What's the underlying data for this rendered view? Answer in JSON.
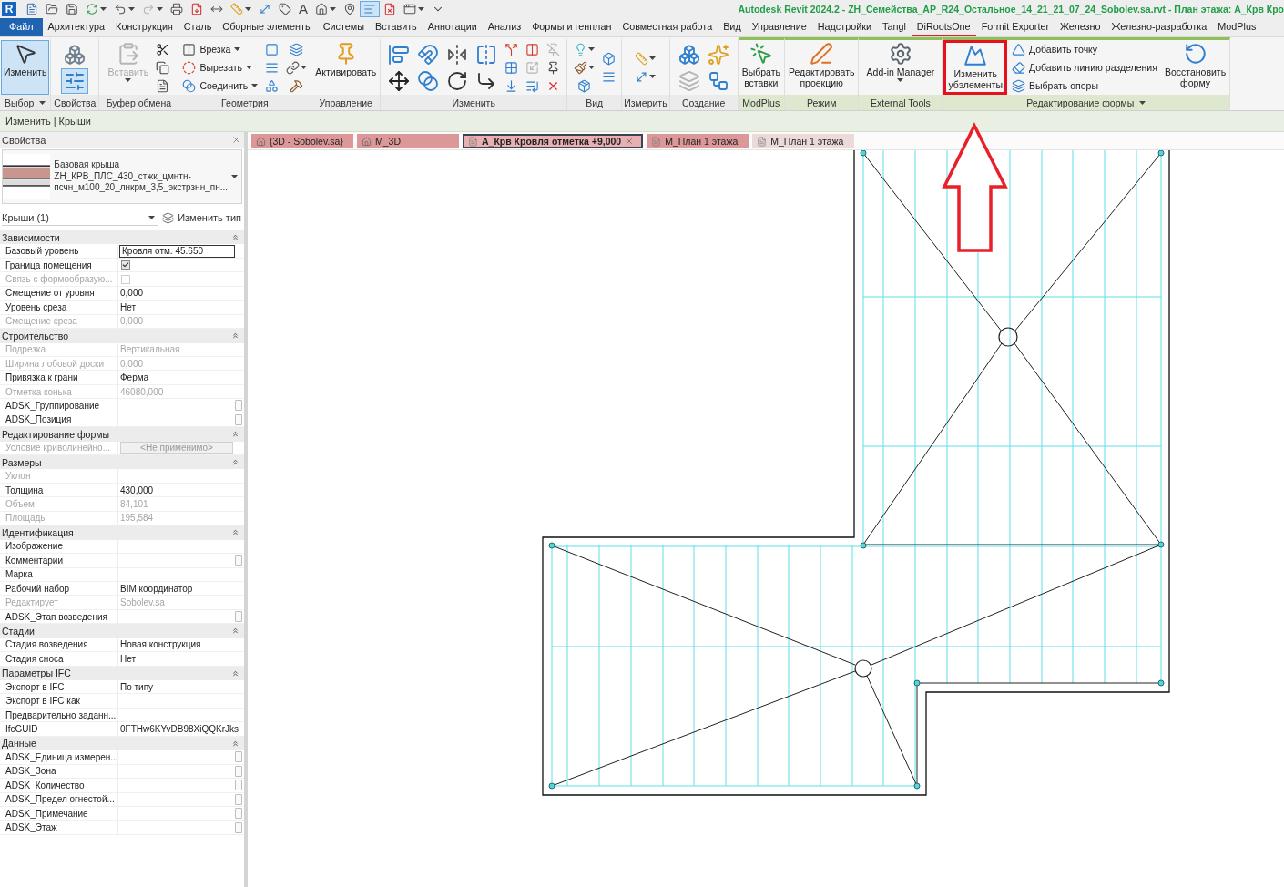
{
  "title_bar": {
    "logo": "R",
    "quick_access": [
      {
        "kind": "icon",
        "selected": false,
        "disabled": false,
        "dropdown": false
      },
      {
        "kind": "icon",
        "selected": false,
        "disabled": false,
        "dropdown": false
      },
      {
        "kind": "icon",
        "selected": false,
        "disabled": false,
        "dropdown": false
      },
      {
        "kind": "icon",
        "selected": false,
        "disabled": false,
        "dropdown": true
      },
      {
        "kind": "icon",
        "selected": false,
        "disabled": false,
        "dropdown": true
      },
      {
        "kind": "icon",
        "selected": false,
        "disabled": true,
        "dropdown": true
      },
      {
        "kind": "icon",
        "selected": false,
        "disabled": false,
        "dropdown": false
      },
      {
        "kind": "icon",
        "selected": false,
        "disabled": false,
        "dropdown": false
      },
      {
        "kind": "icon",
        "selected": false,
        "disabled": false,
        "dropdown": false
      },
      {
        "kind": "icon",
        "selected": false,
        "disabled": false,
        "dropdown": true
      },
      {
        "kind": "icon",
        "selected": false,
        "disabled": false,
        "dropdown": false
      },
      {
        "kind": "icon",
        "selected": false,
        "disabled": false,
        "dropdown": false
      },
      {
        "kind": "glyph",
        "label": "A",
        "selected": false,
        "disabled": false,
        "dropdown": false
      },
      {
        "kind": "icon",
        "selected": false,
        "disabled": false,
        "dropdown": true
      },
      {
        "kind": "icon",
        "selected": false,
        "disabled": false,
        "dropdown": false
      },
      {
        "kind": "icon",
        "selected": true,
        "disabled": false,
        "dropdown": false
      },
      {
        "kind": "icon",
        "selected": false,
        "disabled": false,
        "dropdown": false
      },
      {
        "kind": "icon",
        "selected": false,
        "disabled": false,
        "dropdown": true
      },
      {
        "kind": "icon",
        "selected": false,
        "disabled": false,
        "dropdown": false
      }
    ],
    "title": "Autodesk Revit 2024.2 - ZH_Семейства_АР_R24_Остальное_14_21_21_07_24_Sobolev.sa.rvt - План этажа: А_Крв Кро"
  },
  "menu_tabs": [
    {
      "label": "Файл",
      "kind": "file",
      "selected": false
    },
    {
      "label": "Архитектура",
      "kind": "tab",
      "selected": false
    },
    {
      "label": "Конструкция",
      "kind": "tab",
      "selected": false
    },
    {
      "label": "Сталь",
      "kind": "tab",
      "selected": false
    },
    {
      "label": "Сборные элементы",
      "kind": "tab",
      "selected": false
    },
    {
      "label": "Системы",
      "kind": "tab",
      "selected": false
    },
    {
      "label": "Вставить",
      "kind": "tab",
      "selected": false
    },
    {
      "label": "Аннотации",
      "kind": "tab",
      "selected": false
    },
    {
      "label": "Анализ",
      "kind": "tab",
      "selected": false
    },
    {
      "label": "Формы и генплан",
      "kind": "tab",
      "selected": false
    },
    {
      "label": "Совместная работа",
      "kind": "tab",
      "selected": false
    },
    {
      "label": "Вид",
      "kind": "tab",
      "selected": false
    },
    {
      "label": "Управление",
      "kind": "tab",
      "selected": false
    },
    {
      "label": "Надстройки",
      "kind": "tab",
      "selected": false
    },
    {
      "label": "Tangl",
      "kind": "tab",
      "selected": false
    },
    {
      "label": "DiRootsOne",
      "kind": "underlined",
      "selected": false
    },
    {
      "label": "Formit Exporter",
      "kind": "tab",
      "selected": false
    },
    {
      "label": "Железно",
      "kind": "tab",
      "selected": false
    },
    {
      "label": "Железно-разработка",
      "kind": "tab",
      "selected": false
    },
    {
      "label": "ModPlus",
      "kind": "tab",
      "selected": false
    }
  ],
  "ribbon": {
    "panels": [
      {
        "label": "Выбор",
        "menu": true,
        "contextual": false,
        "buttons": [
          {
            "kind": "large",
            "label": "Изменить",
            "selected": true,
            "disabled": false,
            "dropdown": false,
            "highlighted": false
          }
        ]
      },
      {
        "label": "Свойства",
        "menu": false,
        "contextual": false,
        "buttons": [
          {
            "kind": "icon",
            "selected": false,
            "disabled": false,
            "dropdown": false,
            "highlighted": false
          },
          {
            "kind": "icon",
            "selected": true,
            "disabled": false,
            "dropdown": false,
            "highlighted": false
          }
        ]
      },
      {
        "label": "Буфер обмена",
        "menu": false,
        "contextual": false,
        "buttons": [
          {
            "kind": "large",
            "label": "Вставить",
            "selected": false,
            "disabled": true,
            "dropdown": true,
            "highlighted": false
          },
          {
            "kind": "mini",
            "selected": false,
            "disabled": false,
            "dropdown": false,
            "highlighted": false
          },
          {
            "kind": "mini",
            "selected": false,
            "disabled": false,
            "dropdown": false,
            "highlighted": false
          },
          {
            "kind": "mini",
            "selected": false,
            "disabled": false,
            "dropdown": false,
            "highlighted": false
          }
        ]
      },
      {
        "label": "Геометрия",
        "menu": false,
        "contextual": false,
        "buttons": [
          {
            "kind": "small",
            "label": "Врезка",
            "selected": false,
            "disabled": false,
            "dropdown": true,
            "highlighted": false
          },
          {
            "kind": "small",
            "label": "Вырезать",
            "selected": false,
            "disabled": false,
            "dropdown": true,
            "highlighted": false
          },
          {
            "kind": "small",
            "label": "Соединить",
            "selected": false,
            "disabled": false,
            "dropdown": true,
            "highlighted": false
          },
          {
            "kind": "mini",
            "selected": false,
            "disabled": false,
            "dropdown": false,
            "highlighted": false
          },
          {
            "kind": "mini",
            "selected": false,
            "disabled": false,
            "dropdown": false,
            "highlighted": false
          },
          {
            "kind": "mini",
            "selected": false,
            "disabled": false,
            "dropdown": false,
            "highlighted": false
          },
          {
            "kind": "mini",
            "selected": false,
            "disabled": false,
            "dropdown": false,
            "highlighted": false
          },
          {
            "kind": "mini",
            "selected": false,
            "disabled": false,
            "dropdown": true,
            "highlighted": false
          },
          {
            "kind": "mini",
            "selected": false,
            "disabled": false,
            "dropdown": false,
            "highlighted": false
          }
        ]
      },
      {
        "label": "Управление",
        "menu": false,
        "contextual": false,
        "buttons": [
          {
            "kind": "large",
            "label": "Активировать",
            "selected": false,
            "disabled": false,
            "dropdown": false,
            "highlighted": false
          }
        ]
      },
      {
        "label": "Изменить",
        "menu": false,
        "contextual": false,
        "buttons": [
          {
            "kind": "icon",
            "selected": false,
            "disabled": false,
            "dropdown": false,
            "highlighted": false
          },
          {
            "kind": "icon",
            "selected": false,
            "disabled": false,
            "dropdown": false,
            "highlighted": false
          },
          {
            "kind": "icon",
            "selected": false,
            "disabled": false,
            "dropdown": false,
            "highlighted": false
          },
          {
            "kind": "icon",
            "selected": false,
            "disabled": false,
            "dropdown": false,
            "highlighted": false
          },
          {
            "kind": "icon",
            "selected": false,
            "disabled": false,
            "dropdown": false,
            "highlighted": false
          },
          {
            "kind": "icon",
            "selected": false,
            "disabled": false,
            "dropdown": false,
            "highlighted": false
          },
          {
            "kind": "icon",
            "selected": false,
            "disabled": false,
            "dropdown": false,
            "highlighted": false
          },
          {
            "kind": "icon",
            "selected": false,
            "disabled": false,
            "dropdown": false,
            "highlighted": false
          },
          {
            "kind": "mini",
            "selected": false,
            "disabled": false,
            "dropdown": false,
            "highlighted": false
          },
          {
            "kind": "mini",
            "selected": false,
            "disabled": false,
            "dropdown": false,
            "highlighted": false
          },
          {
            "kind": "mini",
            "selected": false,
            "disabled": false,
            "dropdown": false,
            "highlighted": false
          },
          {
            "kind": "mini",
            "selected": false,
            "disabled": false,
            "dropdown": false,
            "highlighted": false
          },
          {
            "kind": "mini",
            "selected": false,
            "disabled": true,
            "dropdown": false,
            "highlighted": false
          },
          {
            "kind": "mini",
            "selected": false,
            "disabled": false,
            "dropdown": false,
            "highlighted": false
          },
          {
            "kind": "mini",
            "selected": false,
            "disabled": true,
            "dropdown": false,
            "highlighted": false
          },
          {
            "kind": "mini",
            "selected": false,
            "disabled": false,
            "dropdown": false,
            "highlighted": false
          },
          {
            "kind": "mini",
            "selected": false,
            "disabled": false,
            "dropdown": false,
            "highlighted": false
          }
        ]
      },
      {
        "label": "Вид",
        "menu": false,
        "contextual": false,
        "buttons": [
          {
            "kind": "mini",
            "selected": false,
            "disabled": false,
            "dropdown": true,
            "highlighted": false
          },
          {
            "kind": "mini",
            "selected": false,
            "disabled": false,
            "dropdown": true,
            "highlighted": false
          },
          {
            "kind": "mini",
            "selected": false,
            "disabled": false,
            "dropdown": false,
            "highlighted": false
          },
          {
            "kind": "mini",
            "selected": false,
            "disabled": false,
            "dropdown": false,
            "highlighted": false
          },
          {
            "kind": "mini",
            "selected": false,
            "disabled": false,
            "dropdown": false,
            "highlighted": false
          }
        ]
      },
      {
        "label": "Измерить",
        "menu": false,
        "contextual": false,
        "buttons": [
          {
            "kind": "mini",
            "selected": false,
            "disabled": false,
            "dropdown": true,
            "highlighted": false
          },
          {
            "kind": "mini",
            "selected": false,
            "disabled": false,
            "dropdown": true,
            "highlighted": false
          }
        ]
      },
      {
        "label": "Создание",
        "menu": false,
        "contextual": false,
        "buttons": [
          {
            "kind": "icon",
            "selected": false,
            "disabled": false,
            "dropdown": false,
            "highlighted": false
          },
          {
            "kind": "icon",
            "selected": false,
            "disabled": true,
            "dropdown": false,
            "highlighted": false
          },
          {
            "kind": "icon",
            "selected": false,
            "disabled": false,
            "dropdown": false,
            "highlighted": false
          },
          {
            "kind": "icon",
            "selected": false,
            "disabled": false,
            "dropdown": false,
            "highlighted": false
          }
        ]
      },
      {
        "label": "ModPlus",
        "menu": false,
        "contextual": true,
        "buttons": [
          {
            "kind": "large",
            "label": "Выбрать\nвставки",
            "selected": false,
            "disabled": false,
            "dropdown": false,
            "highlighted": false
          }
        ]
      },
      {
        "label": "Режим",
        "menu": false,
        "contextual": true,
        "buttons": [
          {
            "kind": "large",
            "label": "Редактировать\nпроекцию",
            "selected": false,
            "disabled": false,
            "dropdown": false,
            "highlighted": false
          }
        ]
      },
      {
        "label": "External Tools",
        "menu": false,
        "contextual": true,
        "buttons": [
          {
            "kind": "large",
            "label": "Add-in Manager",
            "selected": false,
            "disabled": false,
            "dropdown": true,
            "highlighted": false
          }
        ]
      },
      {
        "label": "Редактирование формы",
        "menu": true,
        "contextual": true,
        "buttons": [
          {
            "kind": "large",
            "label": "Изменить\nубэлементы",
            "selected": false,
            "disabled": false,
            "dropdown": false,
            "highlighted": true
          },
          {
            "kind": "small",
            "label": "Добавить точку",
            "selected": false,
            "disabled": false,
            "dropdown": false,
            "highlighted": false
          },
          {
            "kind": "small",
            "label": "Добавить линию разделения",
            "selected": false,
            "disabled": false,
            "dropdown": false,
            "highlighted": false
          },
          {
            "kind": "small",
            "label": "Выбрать опоры",
            "selected": false,
            "disabled": false,
            "dropdown": false,
            "highlighted": false
          },
          {
            "kind": "large",
            "label": "Восстановить\nформу",
            "selected": false,
            "disabled": false,
            "dropdown": false,
            "highlighted": false
          }
        ]
      }
    ]
  },
  "options_bar": {
    "context": "Изменить | Крыши"
  },
  "properties": {
    "title": "Свойства",
    "type_selector": {
      "family": "Базовая крыша",
      "type_name": "ZH_КРВ_ПЛС_430_стжк_цмнтн-\nпсчн_м100_20_лнкрм_3,5_экстрзнн_пн..."
    },
    "instance_filter": "Крыши (1)",
    "edit_type_button": "Изменить тип",
    "groups": [
      {
        "title": "Зависимости",
        "expanded": true,
        "rows": [
          {
            "name": "Базовый уровень",
            "kind": "field",
            "value": "Кровля отм. 45.650",
            "disabled": false,
            "side_button": false
          },
          {
            "name": "Граница помещения",
            "kind": "checkbox",
            "checked": true,
            "disabled": false,
            "side_button": false
          },
          {
            "name": "Связь с формообразую...",
            "kind": "checkbox",
            "checked": false,
            "disabled": true,
            "side_button": false
          },
          {
            "name": "Смещение от уровня",
            "kind": "text",
            "value": "0,000",
            "disabled": false,
            "side_button": false
          },
          {
            "name": "Уровень среза",
            "kind": "text",
            "value": "Нет",
            "disabled": false,
            "side_button": false
          },
          {
            "name": "Смещение среза",
            "kind": "text",
            "value": "0,000",
            "disabled": true,
            "side_button": false
          }
        ]
      },
      {
        "title": "Строительство",
        "expanded": true,
        "rows": [
          {
            "name": "Подрезка",
            "kind": "text",
            "value": "Вертикальная",
            "disabled": true,
            "side_button": false
          },
          {
            "name": "Ширина лобовой доски",
            "kind": "text",
            "value": "0,000",
            "disabled": true,
            "side_button": false
          },
          {
            "name": "Привязка к грани",
            "kind": "text",
            "value": "Ферма",
            "disabled": false,
            "side_button": false
          },
          {
            "name": "Отметка конька",
            "kind": "text",
            "value": "46080,000",
            "disabled": true,
            "side_button": false
          },
          {
            "name": "ADSK_Группирование",
            "kind": "text",
            "disabled": false,
            "side_button": true
          },
          {
            "name": "ADSK_Позиция",
            "kind": "text",
            "disabled": false,
            "side_button": true
          }
        ]
      },
      {
        "title": "Редактирование формы",
        "expanded": true,
        "rows": [
          {
            "name": "Условие криволинейно...",
            "kind": "button",
            "value": "<Не применимо>",
            "disabled": true,
            "side_button": false
          }
        ]
      },
      {
        "title": "Размеры",
        "expanded": true,
        "rows": [
          {
            "name": "Уклон",
            "kind": "text",
            "disabled": true,
            "side_button": false
          },
          {
            "name": "Толщина",
            "kind": "text",
            "value": "430,000",
            "disabled": false,
            "side_button": false
          },
          {
            "name": "Объем",
            "kind": "text",
            "value": "84,101",
            "disabled": true,
            "side_button": false
          },
          {
            "name": "Площадь",
            "kind": "text",
            "value": "195,584",
            "disabled": true,
            "side_button": false
          }
        ]
      },
      {
        "title": "Идентификация",
        "expanded": true,
        "rows": [
          {
            "name": "Изображение",
            "kind": "text",
            "disabled": false,
            "side_button": false
          },
          {
            "name": "Комментарии",
            "kind": "text",
            "disabled": false,
            "side_button": true
          },
          {
            "name": "Марка",
            "kind": "text",
            "disabled": false,
            "side_button": false
          },
          {
            "name": "Рабочий набор",
            "kind": "text",
            "value": "BIM координатор",
            "disabled": false,
            "side_button": false
          },
          {
            "name": "Редактирует",
            "kind": "text",
            "value": "Sobolev.sa",
            "disabled": true,
            "side_button": false
          },
          {
            "name": "ADSK_Этап возведения",
            "kind": "text",
            "disabled": false,
            "side_button": true
          }
        ]
      },
      {
        "title": "Стадии",
        "expanded": true,
        "rows": [
          {
            "name": "Стадия возведения",
            "kind": "text",
            "value": "Новая конструкция",
            "disabled": false,
            "side_button": false
          },
          {
            "name": "Стадия сноса",
            "kind": "text",
            "value": "Нет",
            "disabled": false,
            "side_button": false
          }
        ]
      },
      {
        "title": "Параметры IFC",
        "expanded": true,
        "rows": [
          {
            "name": "Экспорт в IFC",
            "kind": "text",
            "value": "По типу",
            "disabled": false,
            "side_button": false
          },
          {
            "name": "Экспорт в IFC как",
            "kind": "text",
            "disabled": false,
            "side_button": false
          },
          {
            "name": "Предварительно заданн...",
            "kind": "text",
            "disabled": false,
            "side_button": false
          },
          {
            "name": "IfcGUID",
            "kind": "text",
            "value": "0FTHw6KYvDB98XiQQKrJks",
            "disabled": false,
            "side_button": false
          }
        ]
      },
      {
        "title": "Данные",
        "expanded": true,
        "rows": [
          {
            "name": "ADSK_Единица измерен...",
            "kind": "text",
            "disabled": false,
            "side_button": true
          },
          {
            "name": "ADSK_Зона",
            "kind": "text",
            "disabled": false,
            "side_button": true
          },
          {
            "name": "ADSK_Количество",
            "kind": "text",
            "disabled": false,
            "side_button": true
          },
          {
            "name": "ADSK_Предел огнестой...",
            "kind": "text",
            "disabled": false,
            "side_button": true
          },
          {
            "name": "ADSK_Примечание",
            "kind": "text",
            "disabled": false,
            "side_button": true
          },
          {
            "name": "ADSK_Этаж",
            "kind": "text",
            "disabled": false,
            "side_button": true
          }
        ]
      }
    ]
  },
  "view_tabs": [
    {
      "label": "{3D - Sobolev.sa}",
      "kind": "perspective",
      "selected": false,
      "color": "#dc9898"
    },
    {
      "label": "М_3D",
      "kind": "perspective",
      "selected": false,
      "color": "#dc9898"
    },
    {
      "label": "А_Крв Кровля отметка +9,000",
      "kind": "plan",
      "selected": true,
      "color": "#e8b0b0"
    },
    {
      "label": "М_План 1 этажа",
      "kind": "plan",
      "selected": false,
      "color": "#dc9898"
    },
    {
      "label": "М_План 1 этажа",
      "kind": "plan",
      "selected": false,
      "color": "#ecdada"
    }
  ]
}
